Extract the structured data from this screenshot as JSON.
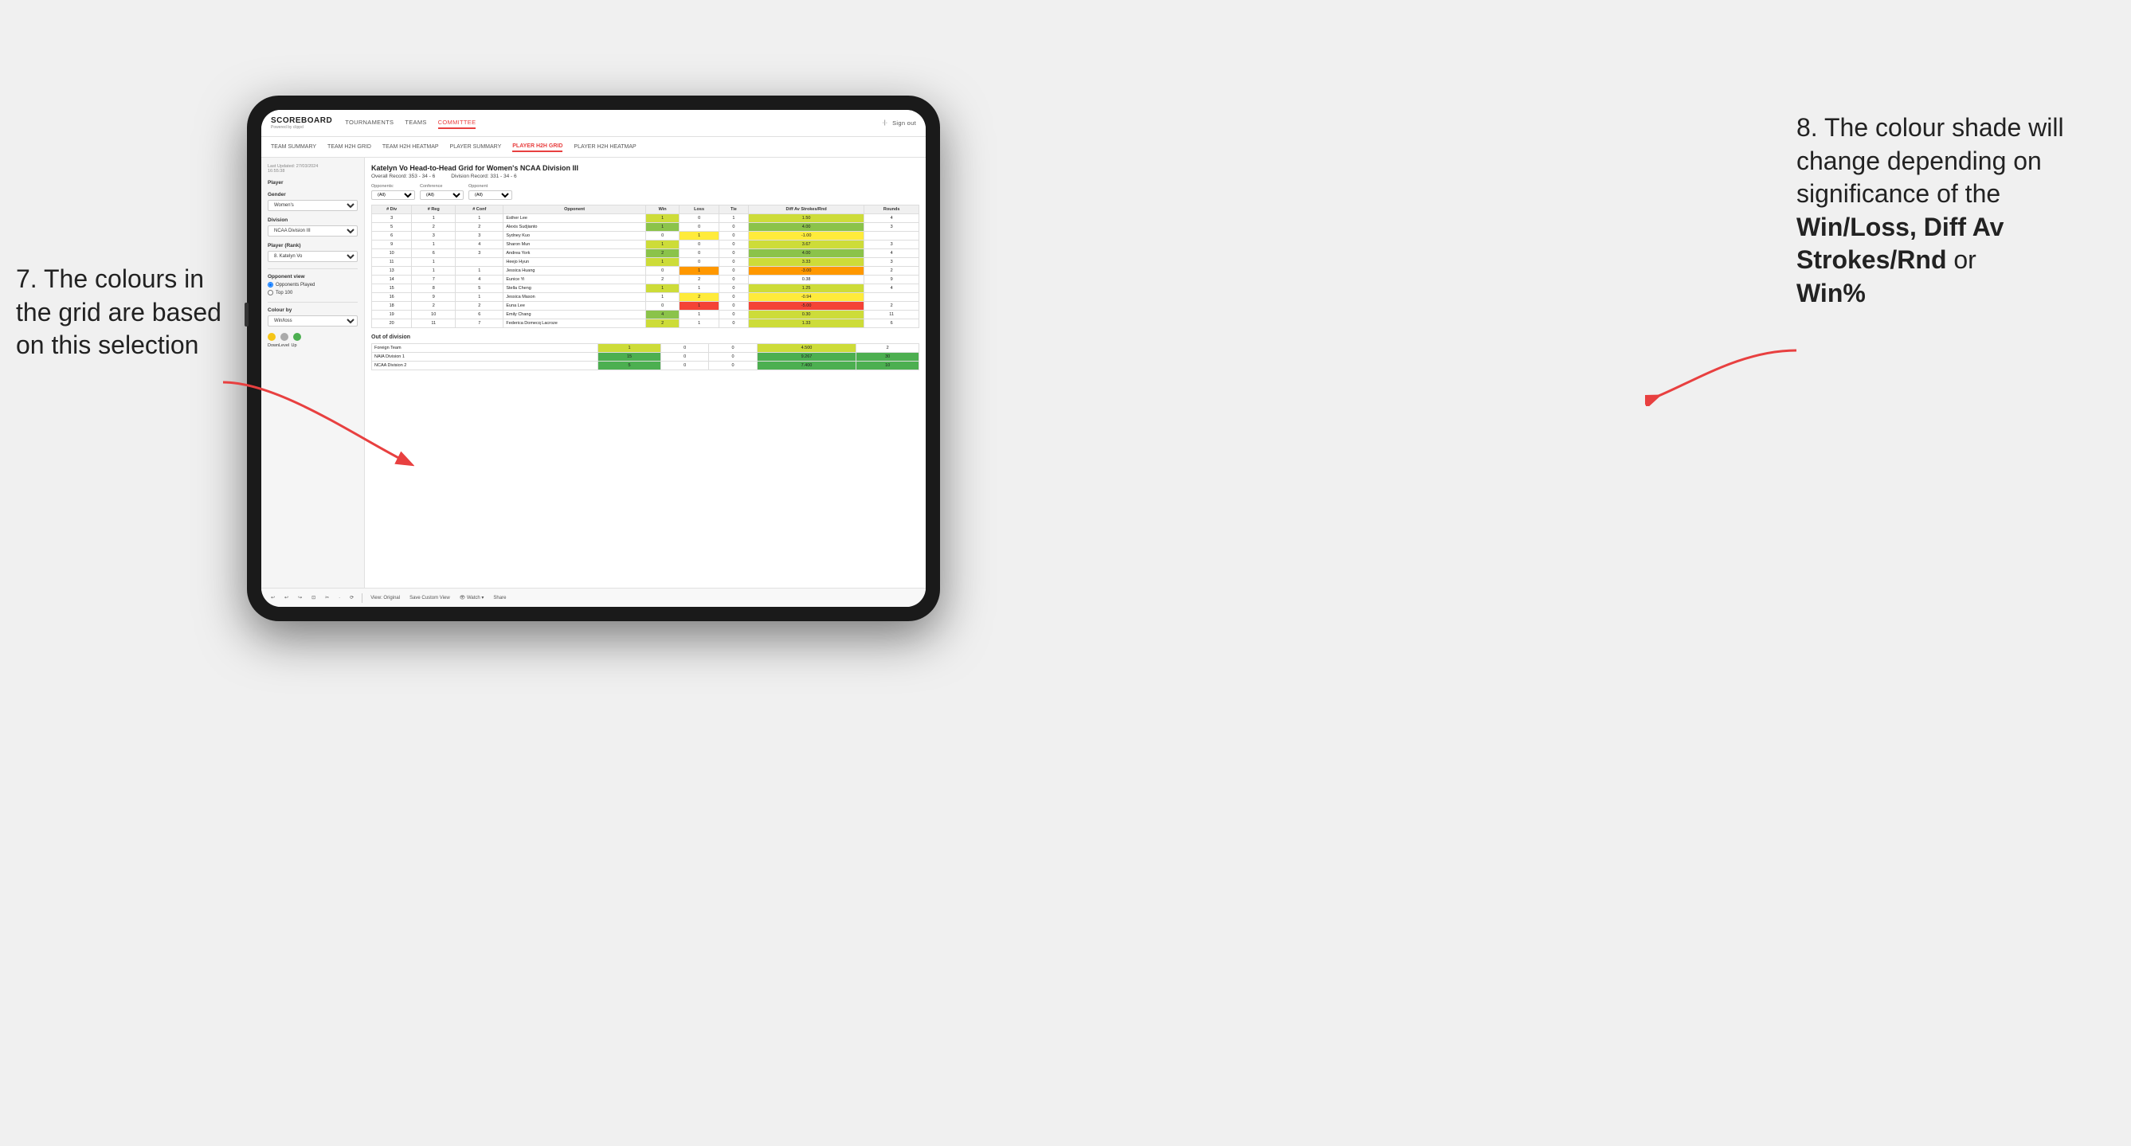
{
  "nav": {
    "logo": "SCOREBOARD",
    "logo_sub": "Powered by clippd",
    "links": [
      "TOURNAMENTS",
      "TEAMS",
      "COMMITTEE"
    ],
    "active_link": "COMMITTEE",
    "right_links": [
      "Sign out"
    ]
  },
  "sub_nav": {
    "links": [
      "TEAM SUMMARY",
      "TEAM H2H GRID",
      "TEAM H2H HEATMAP",
      "PLAYER SUMMARY",
      "PLAYER H2H GRID",
      "PLAYER H2H HEATMAP"
    ],
    "active_link": "PLAYER H2H GRID"
  },
  "sidebar": {
    "timestamp_label": "Last Updated: 27/03/2024",
    "timestamp_time": "16:55:38",
    "player_section": "Player",
    "gender_label": "Gender",
    "gender_value": "Women's",
    "division_label": "Division",
    "division_value": "NCAA Division III",
    "player_rank_label": "Player (Rank)",
    "player_rank_value": "8. Katelyn Vo",
    "opponent_view_label": "Opponent view",
    "radio_options": [
      "Opponents Played",
      "Top 100"
    ],
    "colour_by_label": "Colour by",
    "colour_by_value": "Win/loss",
    "legend_dots": [
      {
        "color": "#f5c518",
        "label": "Down"
      },
      {
        "color": "#aaa",
        "label": "Level"
      },
      {
        "color": "#4caf50",
        "label": "Up"
      }
    ]
  },
  "grid": {
    "title": "Katelyn Vo Head-to-Head Grid for Women's NCAA Division III",
    "overall_record_label": "Overall Record:",
    "overall_record_value": "353 - 34 - 6",
    "division_record_label": "Division Record:",
    "division_record_value": "331 - 34 - 6",
    "filters": [
      {
        "label": "Opponents:",
        "value": "(All)"
      },
      {
        "label": "Conference",
        "value": "(All)"
      },
      {
        "label": "Opponent",
        "value": "(All)"
      }
    ],
    "table_headers": [
      "# Div",
      "# Reg",
      "# Conf",
      "Opponent",
      "Win",
      "Loss",
      "Tie",
      "Diff Av Strokes/Rnd",
      "Rounds"
    ],
    "rows": [
      {
        "div": 3,
        "reg": 1,
        "conf": 1,
        "name": "Esther Lee",
        "win": 1,
        "loss": 0,
        "tie": 1,
        "diff": "1.50",
        "rounds": 4,
        "win_class": "cell-win-light",
        "diff_class": "cell-win-light"
      },
      {
        "div": 5,
        "reg": 2,
        "conf": 2,
        "name": "Alexis Sudjianto",
        "win": 1,
        "loss": 0,
        "tie": 0,
        "diff": "4.00",
        "rounds": 3,
        "win_class": "cell-win-medium",
        "diff_class": "cell-win-medium"
      },
      {
        "div": 6,
        "reg": 3,
        "conf": 3,
        "name": "Sydney Kuo",
        "win": 0,
        "loss": 1,
        "tie": 0,
        "diff": "-1.00",
        "rounds": "",
        "win_class": "cell-loss-light",
        "diff_class": "cell-loss-light"
      },
      {
        "div": 9,
        "reg": 1,
        "conf": 4,
        "name": "Sharon Mun",
        "win": 1,
        "loss": 0,
        "tie": 0,
        "diff": "3.67",
        "rounds": 3,
        "win_class": "cell-win-light",
        "diff_class": "cell-win-light"
      },
      {
        "div": 10,
        "reg": 6,
        "conf": 3,
        "name": "Andrea York",
        "win": 2,
        "loss": 0,
        "tie": 0,
        "diff": "4.00",
        "rounds": 4,
        "win_class": "cell-win-medium",
        "diff_class": "cell-win-medium"
      },
      {
        "div": 11,
        "reg": 1,
        "conf": "",
        "name": "Heejo Hyun",
        "win": 1,
        "loss": 0,
        "tie": 0,
        "diff": "3.33",
        "rounds": 3,
        "win_class": "cell-win-light",
        "diff_class": "cell-win-light"
      },
      {
        "div": 13,
        "reg": 1,
        "conf": 1,
        "name": "Jessica Huang",
        "win": 0,
        "loss": 1,
        "tie": 0,
        "diff": "-3.00",
        "rounds": 2,
        "win_class": "cell-loss-medium",
        "diff_class": "cell-loss-medium"
      },
      {
        "div": 14,
        "reg": 7,
        "conf": 4,
        "name": "Eunice Yi",
        "win": 2,
        "loss": 2,
        "tie": 0,
        "diff": "0.38",
        "rounds": 9,
        "win_class": "cell-neutral",
        "diff_class": "cell-neutral"
      },
      {
        "div": 15,
        "reg": 8,
        "conf": 5,
        "name": "Stella Cheng",
        "win": 1,
        "loss": 1,
        "tie": 0,
        "diff": "1.25",
        "rounds": 4,
        "win_class": "cell-win-light",
        "diff_class": "cell-win-light"
      },
      {
        "div": 16,
        "reg": 9,
        "conf": 1,
        "name": "Jessica Mason",
        "win": 1,
        "loss": 2,
        "tie": 0,
        "diff": "-0.94",
        "rounds": "",
        "win_class": "cell-loss-light",
        "diff_class": "cell-loss-light"
      },
      {
        "div": 18,
        "reg": 2,
        "conf": 2,
        "name": "Euna Lee",
        "win": 0,
        "loss": 1,
        "tie": 0,
        "diff": "-5.00",
        "rounds": 2,
        "win_class": "cell-loss-strong",
        "diff_class": "cell-loss-strong"
      },
      {
        "div": 19,
        "reg": 10,
        "conf": 6,
        "name": "Emily Chang",
        "win": 4,
        "loss": 1,
        "tie": 0,
        "diff": "0.30",
        "rounds": 11,
        "win_class": "cell-win-light",
        "diff_class": "cell-win-light"
      },
      {
        "div": 20,
        "reg": 11,
        "conf": 7,
        "name": "Federica Domecq Lacroze",
        "win": 2,
        "loss": 1,
        "tie": 0,
        "diff": "1.33",
        "rounds": 6,
        "win_class": "cell-win-light",
        "diff_class": "cell-win-light"
      }
    ],
    "out_of_division_label": "Out of division",
    "out_of_division_rows": [
      {
        "name": "Foreign Team",
        "win": 1,
        "loss": 0,
        "tie": 0,
        "diff": "4.500",
        "rounds": 2,
        "win_class": "cell-win-medium",
        "diff_class": "cell-win-medium"
      },
      {
        "name": "NAIA Division 1",
        "win": 15,
        "loss": 0,
        "tie": 0,
        "diff": "9.267",
        "rounds": 30,
        "win_class": "cell-win-strong",
        "diff_class": "cell-win-strong"
      },
      {
        "name": "NCAA Division 2",
        "win": 5,
        "loss": 0,
        "tie": 0,
        "diff": "7.400",
        "rounds": 10,
        "win_class": "cell-win-strong",
        "diff_class": "cell-win-strong"
      }
    ]
  },
  "toolbar": {
    "buttons": [
      "↩",
      "↩",
      "↪",
      "⊡",
      "✂",
      "·",
      "⟳",
      "|",
      "View: Original",
      "Save Custom View",
      "👁 Watch ▾",
      "⇥",
      "⇄",
      "Share"
    ]
  },
  "annotations": {
    "left_title": "7. The colours in the grid are based on this selection",
    "right_title": "8. The colour shade will change depending on significance of the",
    "right_bold": "Win/Loss, Diff Av Strokes/Rnd",
    "right_suffix": "or",
    "right_bold2": "Win%"
  }
}
